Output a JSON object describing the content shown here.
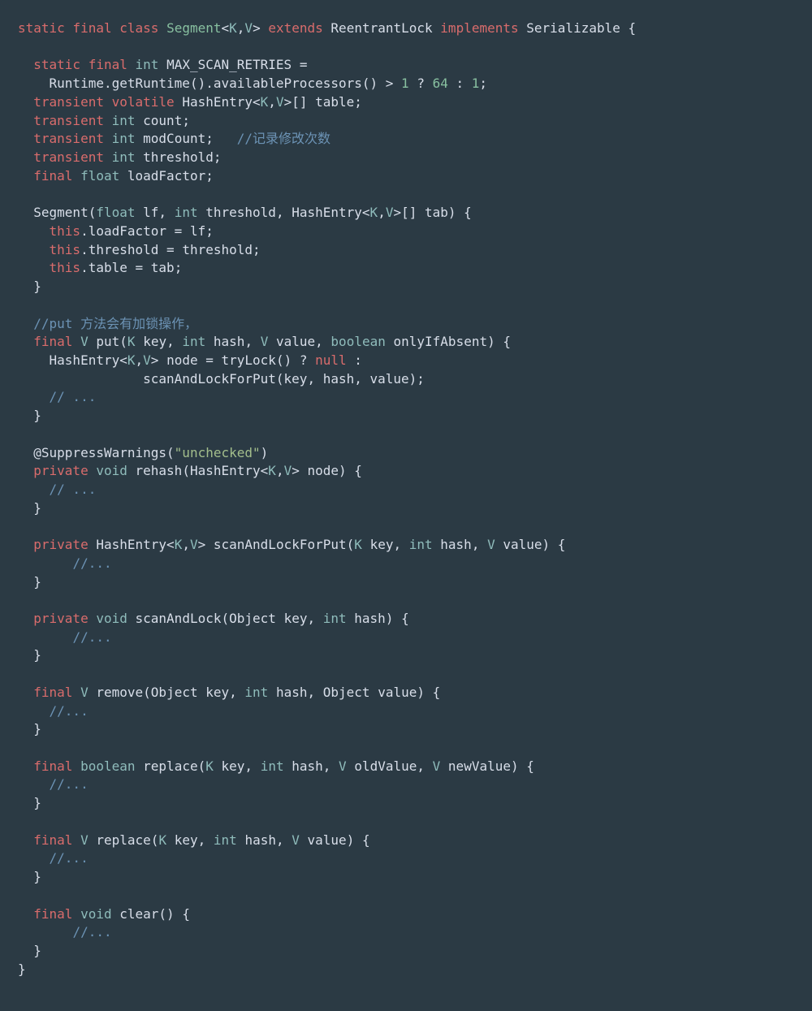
{
  "code": {
    "lines": [
      [
        [
          "kw",
          "static"
        ],
        [
          "op",
          " "
        ],
        [
          "kw",
          "final"
        ],
        [
          "op",
          " "
        ],
        [
          "kw",
          "class"
        ],
        [
          "op",
          " "
        ],
        [
          "name",
          "Segment"
        ],
        [
          "op",
          "<"
        ],
        [
          "tp",
          "K"
        ],
        [
          "op",
          ","
        ],
        [
          "tp",
          "V"
        ],
        [
          "op",
          ">"
        ],
        [
          "op",
          " "
        ],
        [
          "kw",
          "extends"
        ],
        [
          "op",
          " "
        ],
        [
          "cls",
          "ReentrantLock"
        ],
        [
          "op",
          " "
        ],
        [
          "kw",
          "implements"
        ],
        [
          "op",
          " "
        ],
        [
          "cls",
          "Serializable"
        ],
        [
          "op",
          " {"
        ]
      ],
      [],
      [
        [
          "op",
          "  "
        ],
        [
          "kw",
          "static"
        ],
        [
          "op",
          " "
        ],
        [
          "kw",
          "final"
        ],
        [
          "op",
          " "
        ],
        [
          "type",
          "int"
        ],
        [
          "op",
          " "
        ],
        [
          "id",
          "MAX_SCAN_RETRIES"
        ],
        [
          "op",
          " ="
        ]
      ],
      [
        [
          "op",
          "    "
        ],
        [
          "cls",
          "Runtime"
        ],
        [
          "op",
          "."
        ],
        [
          "fn",
          "getRuntime"
        ],
        [
          "op",
          "()."
        ],
        [
          "fn",
          "availableProcessors"
        ],
        [
          "op",
          "() > "
        ],
        [
          "num",
          "1"
        ],
        [
          "op",
          " ? "
        ],
        [
          "num",
          "64"
        ],
        [
          "op",
          " : "
        ],
        [
          "num",
          "1"
        ],
        [
          "op",
          ";"
        ]
      ],
      [
        [
          "op",
          "  "
        ],
        [
          "kw",
          "transient"
        ],
        [
          "op",
          " "
        ],
        [
          "kw",
          "volatile"
        ],
        [
          "op",
          " "
        ],
        [
          "cls",
          "HashEntry"
        ],
        [
          "op",
          "<"
        ],
        [
          "tp",
          "K"
        ],
        [
          "op",
          ","
        ],
        [
          "tp",
          "V"
        ],
        [
          "op",
          ">[] "
        ],
        [
          "id",
          "table"
        ],
        [
          "op",
          ";"
        ]
      ],
      [
        [
          "op",
          "  "
        ],
        [
          "kw",
          "transient"
        ],
        [
          "op",
          " "
        ],
        [
          "type",
          "int"
        ],
        [
          "op",
          " "
        ],
        [
          "id",
          "count"
        ],
        [
          "op",
          ";"
        ]
      ],
      [
        [
          "op",
          "  "
        ],
        [
          "kw",
          "transient"
        ],
        [
          "op",
          " "
        ],
        [
          "type",
          "int"
        ],
        [
          "op",
          " "
        ],
        [
          "id",
          "modCount"
        ],
        [
          "op",
          ";   "
        ],
        [
          "cmt",
          "//记录修改次数"
        ]
      ],
      [
        [
          "op",
          "  "
        ],
        [
          "kw",
          "transient"
        ],
        [
          "op",
          " "
        ],
        [
          "type",
          "int"
        ],
        [
          "op",
          " "
        ],
        [
          "id",
          "threshold"
        ],
        [
          "op",
          ";"
        ]
      ],
      [
        [
          "op",
          "  "
        ],
        [
          "kw",
          "final"
        ],
        [
          "op",
          " "
        ],
        [
          "type",
          "float"
        ],
        [
          "op",
          " "
        ],
        [
          "id",
          "loadFactor"
        ],
        [
          "op",
          ";"
        ]
      ],
      [],
      [
        [
          "op",
          "  "
        ],
        [
          "fn",
          "Segment"
        ],
        [
          "op",
          "("
        ],
        [
          "type",
          "float"
        ],
        [
          "op",
          " "
        ],
        [
          "id",
          "lf"
        ],
        [
          "op",
          ", "
        ],
        [
          "type",
          "int"
        ],
        [
          "op",
          " "
        ],
        [
          "id",
          "threshold"
        ],
        [
          "op",
          ", "
        ],
        [
          "cls",
          "HashEntry"
        ],
        [
          "op",
          "<"
        ],
        [
          "tp",
          "K"
        ],
        [
          "op",
          ","
        ],
        [
          "tp",
          "V"
        ],
        [
          "op",
          ">[] "
        ],
        [
          "id",
          "tab"
        ],
        [
          "op",
          ") {"
        ]
      ],
      [
        [
          "op",
          "    "
        ],
        [
          "kw",
          "this"
        ],
        [
          "op",
          "."
        ],
        [
          "id",
          "loadFactor"
        ],
        [
          "op",
          " = "
        ],
        [
          "id",
          "lf"
        ],
        [
          "op",
          ";"
        ]
      ],
      [
        [
          "op",
          "    "
        ],
        [
          "kw",
          "this"
        ],
        [
          "op",
          "."
        ],
        [
          "id",
          "threshold"
        ],
        [
          "op",
          " = "
        ],
        [
          "id",
          "threshold"
        ],
        [
          "op",
          ";"
        ]
      ],
      [
        [
          "op",
          "    "
        ],
        [
          "kw",
          "this"
        ],
        [
          "op",
          "."
        ],
        [
          "id",
          "table"
        ],
        [
          "op",
          " = "
        ],
        [
          "id",
          "tab"
        ],
        [
          "op",
          ";"
        ]
      ],
      [
        [
          "op",
          "  }"
        ]
      ],
      [],
      [
        [
          "op",
          "  "
        ],
        [
          "cmt",
          "//put 方法会有加锁操作，"
        ]
      ],
      [
        [
          "op",
          "  "
        ],
        [
          "kw",
          "final"
        ],
        [
          "op",
          " "
        ],
        [
          "type",
          "V"
        ],
        [
          "op",
          " "
        ],
        [
          "fn",
          "put"
        ],
        [
          "op",
          "("
        ],
        [
          "type",
          "K"
        ],
        [
          "op",
          " "
        ],
        [
          "id",
          "key"
        ],
        [
          "op",
          ", "
        ],
        [
          "type",
          "int"
        ],
        [
          "op",
          " "
        ],
        [
          "id",
          "hash"
        ],
        [
          "op",
          ", "
        ],
        [
          "type",
          "V"
        ],
        [
          "op",
          " "
        ],
        [
          "id",
          "value"
        ],
        [
          "op",
          ", "
        ],
        [
          "type",
          "boolean"
        ],
        [
          "op",
          " "
        ],
        [
          "id",
          "onlyIfAbsent"
        ],
        [
          "op",
          ") {"
        ]
      ],
      [
        [
          "op",
          "    "
        ],
        [
          "cls",
          "HashEntry"
        ],
        [
          "op",
          "<"
        ],
        [
          "tp",
          "K"
        ],
        [
          "op",
          ","
        ],
        [
          "tp",
          "V"
        ],
        [
          "op",
          "> "
        ],
        [
          "id",
          "node"
        ],
        [
          "op",
          " = "
        ],
        [
          "fn",
          "tryLock"
        ],
        [
          "op",
          "() ? "
        ],
        [
          "kw",
          "null"
        ],
        [
          "op",
          " :"
        ]
      ],
      [
        [
          "op",
          "                "
        ],
        [
          "fn",
          "scanAndLockForPut"
        ],
        [
          "op",
          "("
        ],
        [
          "id",
          "key"
        ],
        [
          "op",
          ", "
        ],
        [
          "id",
          "hash"
        ],
        [
          "op",
          ", "
        ],
        [
          "id",
          "value"
        ],
        [
          "op",
          ");"
        ]
      ],
      [
        [
          "op",
          "    "
        ],
        [
          "cmt",
          "// ..."
        ]
      ],
      [
        [
          "op",
          "  }"
        ]
      ],
      [],
      [
        [
          "op",
          "  "
        ],
        [
          "ann",
          "@SuppressWarnings"
        ],
        [
          "op",
          "("
        ],
        [
          "str",
          "\"unchecked\""
        ],
        [
          "op",
          ")"
        ]
      ],
      [
        [
          "op",
          "  "
        ],
        [
          "kw",
          "private"
        ],
        [
          "op",
          " "
        ],
        [
          "type",
          "void"
        ],
        [
          "op",
          " "
        ],
        [
          "fn",
          "rehash"
        ],
        [
          "op",
          "("
        ],
        [
          "cls",
          "HashEntry"
        ],
        [
          "op",
          "<"
        ],
        [
          "tp",
          "K"
        ],
        [
          "op",
          ","
        ],
        [
          "tp",
          "V"
        ],
        [
          "op",
          "> "
        ],
        [
          "id",
          "node"
        ],
        [
          "op",
          ") {"
        ]
      ],
      [
        [
          "op",
          "    "
        ],
        [
          "cmt",
          "// ..."
        ]
      ],
      [
        [
          "op",
          "  }"
        ]
      ],
      [],
      [
        [
          "op",
          "  "
        ],
        [
          "kw",
          "private"
        ],
        [
          "op",
          " "
        ],
        [
          "cls",
          "HashEntry"
        ],
        [
          "op",
          "<"
        ],
        [
          "tp",
          "K"
        ],
        [
          "op",
          ","
        ],
        [
          "tp",
          "V"
        ],
        [
          "op",
          "> "
        ],
        [
          "fn",
          "scanAndLockForPut"
        ],
        [
          "op",
          "("
        ],
        [
          "type",
          "K"
        ],
        [
          "op",
          " "
        ],
        [
          "id",
          "key"
        ],
        [
          "op",
          ", "
        ],
        [
          "type",
          "int"
        ],
        [
          "op",
          " "
        ],
        [
          "id",
          "hash"
        ],
        [
          "op",
          ", "
        ],
        [
          "type",
          "V"
        ],
        [
          "op",
          " "
        ],
        [
          "id",
          "value"
        ],
        [
          "op",
          ") {"
        ]
      ],
      [
        [
          "op",
          "       "
        ],
        [
          "cmt",
          "//..."
        ]
      ],
      [
        [
          "op",
          "  }"
        ]
      ],
      [],
      [
        [
          "op",
          "  "
        ],
        [
          "kw",
          "private"
        ],
        [
          "op",
          " "
        ],
        [
          "type",
          "void"
        ],
        [
          "op",
          " "
        ],
        [
          "fn",
          "scanAndLock"
        ],
        [
          "op",
          "("
        ],
        [
          "cls",
          "Object"
        ],
        [
          "op",
          " "
        ],
        [
          "id",
          "key"
        ],
        [
          "op",
          ", "
        ],
        [
          "type",
          "int"
        ],
        [
          "op",
          " "
        ],
        [
          "id",
          "hash"
        ],
        [
          "op",
          ") {"
        ]
      ],
      [
        [
          "op",
          "       "
        ],
        [
          "cmt",
          "//..."
        ]
      ],
      [
        [
          "op",
          "  }"
        ]
      ],
      [],
      [
        [
          "op",
          "  "
        ],
        [
          "kw",
          "final"
        ],
        [
          "op",
          " "
        ],
        [
          "type",
          "V"
        ],
        [
          "op",
          " "
        ],
        [
          "fn",
          "remove"
        ],
        [
          "op",
          "("
        ],
        [
          "cls",
          "Object"
        ],
        [
          "op",
          " "
        ],
        [
          "id",
          "key"
        ],
        [
          "op",
          ", "
        ],
        [
          "type",
          "int"
        ],
        [
          "op",
          " "
        ],
        [
          "id",
          "hash"
        ],
        [
          "op",
          ", "
        ],
        [
          "cls",
          "Object"
        ],
        [
          "op",
          " "
        ],
        [
          "id",
          "value"
        ],
        [
          "op",
          ") {"
        ]
      ],
      [
        [
          "op",
          "    "
        ],
        [
          "cmt",
          "//..."
        ]
      ],
      [
        [
          "op",
          "  }"
        ]
      ],
      [],
      [
        [
          "op",
          "  "
        ],
        [
          "kw",
          "final"
        ],
        [
          "op",
          " "
        ],
        [
          "type",
          "boolean"
        ],
        [
          "op",
          " "
        ],
        [
          "fn",
          "replace"
        ],
        [
          "op",
          "("
        ],
        [
          "type",
          "K"
        ],
        [
          "op",
          " "
        ],
        [
          "id",
          "key"
        ],
        [
          "op",
          ", "
        ],
        [
          "type",
          "int"
        ],
        [
          "op",
          " "
        ],
        [
          "id",
          "hash"
        ],
        [
          "op",
          ", "
        ],
        [
          "type",
          "V"
        ],
        [
          "op",
          " "
        ],
        [
          "id",
          "oldValue"
        ],
        [
          "op",
          ", "
        ],
        [
          "type",
          "V"
        ],
        [
          "op",
          " "
        ],
        [
          "id",
          "newValue"
        ],
        [
          "op",
          ") {"
        ]
      ],
      [
        [
          "op",
          "    "
        ],
        [
          "cmt",
          "//..."
        ]
      ],
      [
        [
          "op",
          "  }"
        ]
      ],
      [],
      [
        [
          "op",
          "  "
        ],
        [
          "kw",
          "final"
        ],
        [
          "op",
          " "
        ],
        [
          "type",
          "V"
        ],
        [
          "op",
          " "
        ],
        [
          "fn",
          "replace"
        ],
        [
          "op",
          "("
        ],
        [
          "type",
          "K"
        ],
        [
          "op",
          " "
        ],
        [
          "id",
          "key"
        ],
        [
          "op",
          ", "
        ],
        [
          "type",
          "int"
        ],
        [
          "op",
          " "
        ],
        [
          "id",
          "hash"
        ],
        [
          "op",
          ", "
        ],
        [
          "type",
          "V"
        ],
        [
          "op",
          " "
        ],
        [
          "id",
          "value"
        ],
        [
          "op",
          ") {"
        ]
      ],
      [
        [
          "op",
          "    "
        ],
        [
          "cmt",
          "//..."
        ]
      ],
      [
        [
          "op",
          "  }"
        ]
      ],
      [],
      [
        [
          "op",
          "  "
        ],
        [
          "kw",
          "final"
        ],
        [
          "op",
          " "
        ],
        [
          "type",
          "void"
        ],
        [
          "op",
          " "
        ],
        [
          "fn",
          "clear"
        ],
        [
          "op",
          "() {"
        ]
      ],
      [
        [
          "op",
          "       "
        ],
        [
          "cmt",
          "//..."
        ]
      ],
      [
        [
          "op",
          "  }"
        ]
      ],
      [
        [
          "op",
          "}"
        ]
      ]
    ]
  }
}
